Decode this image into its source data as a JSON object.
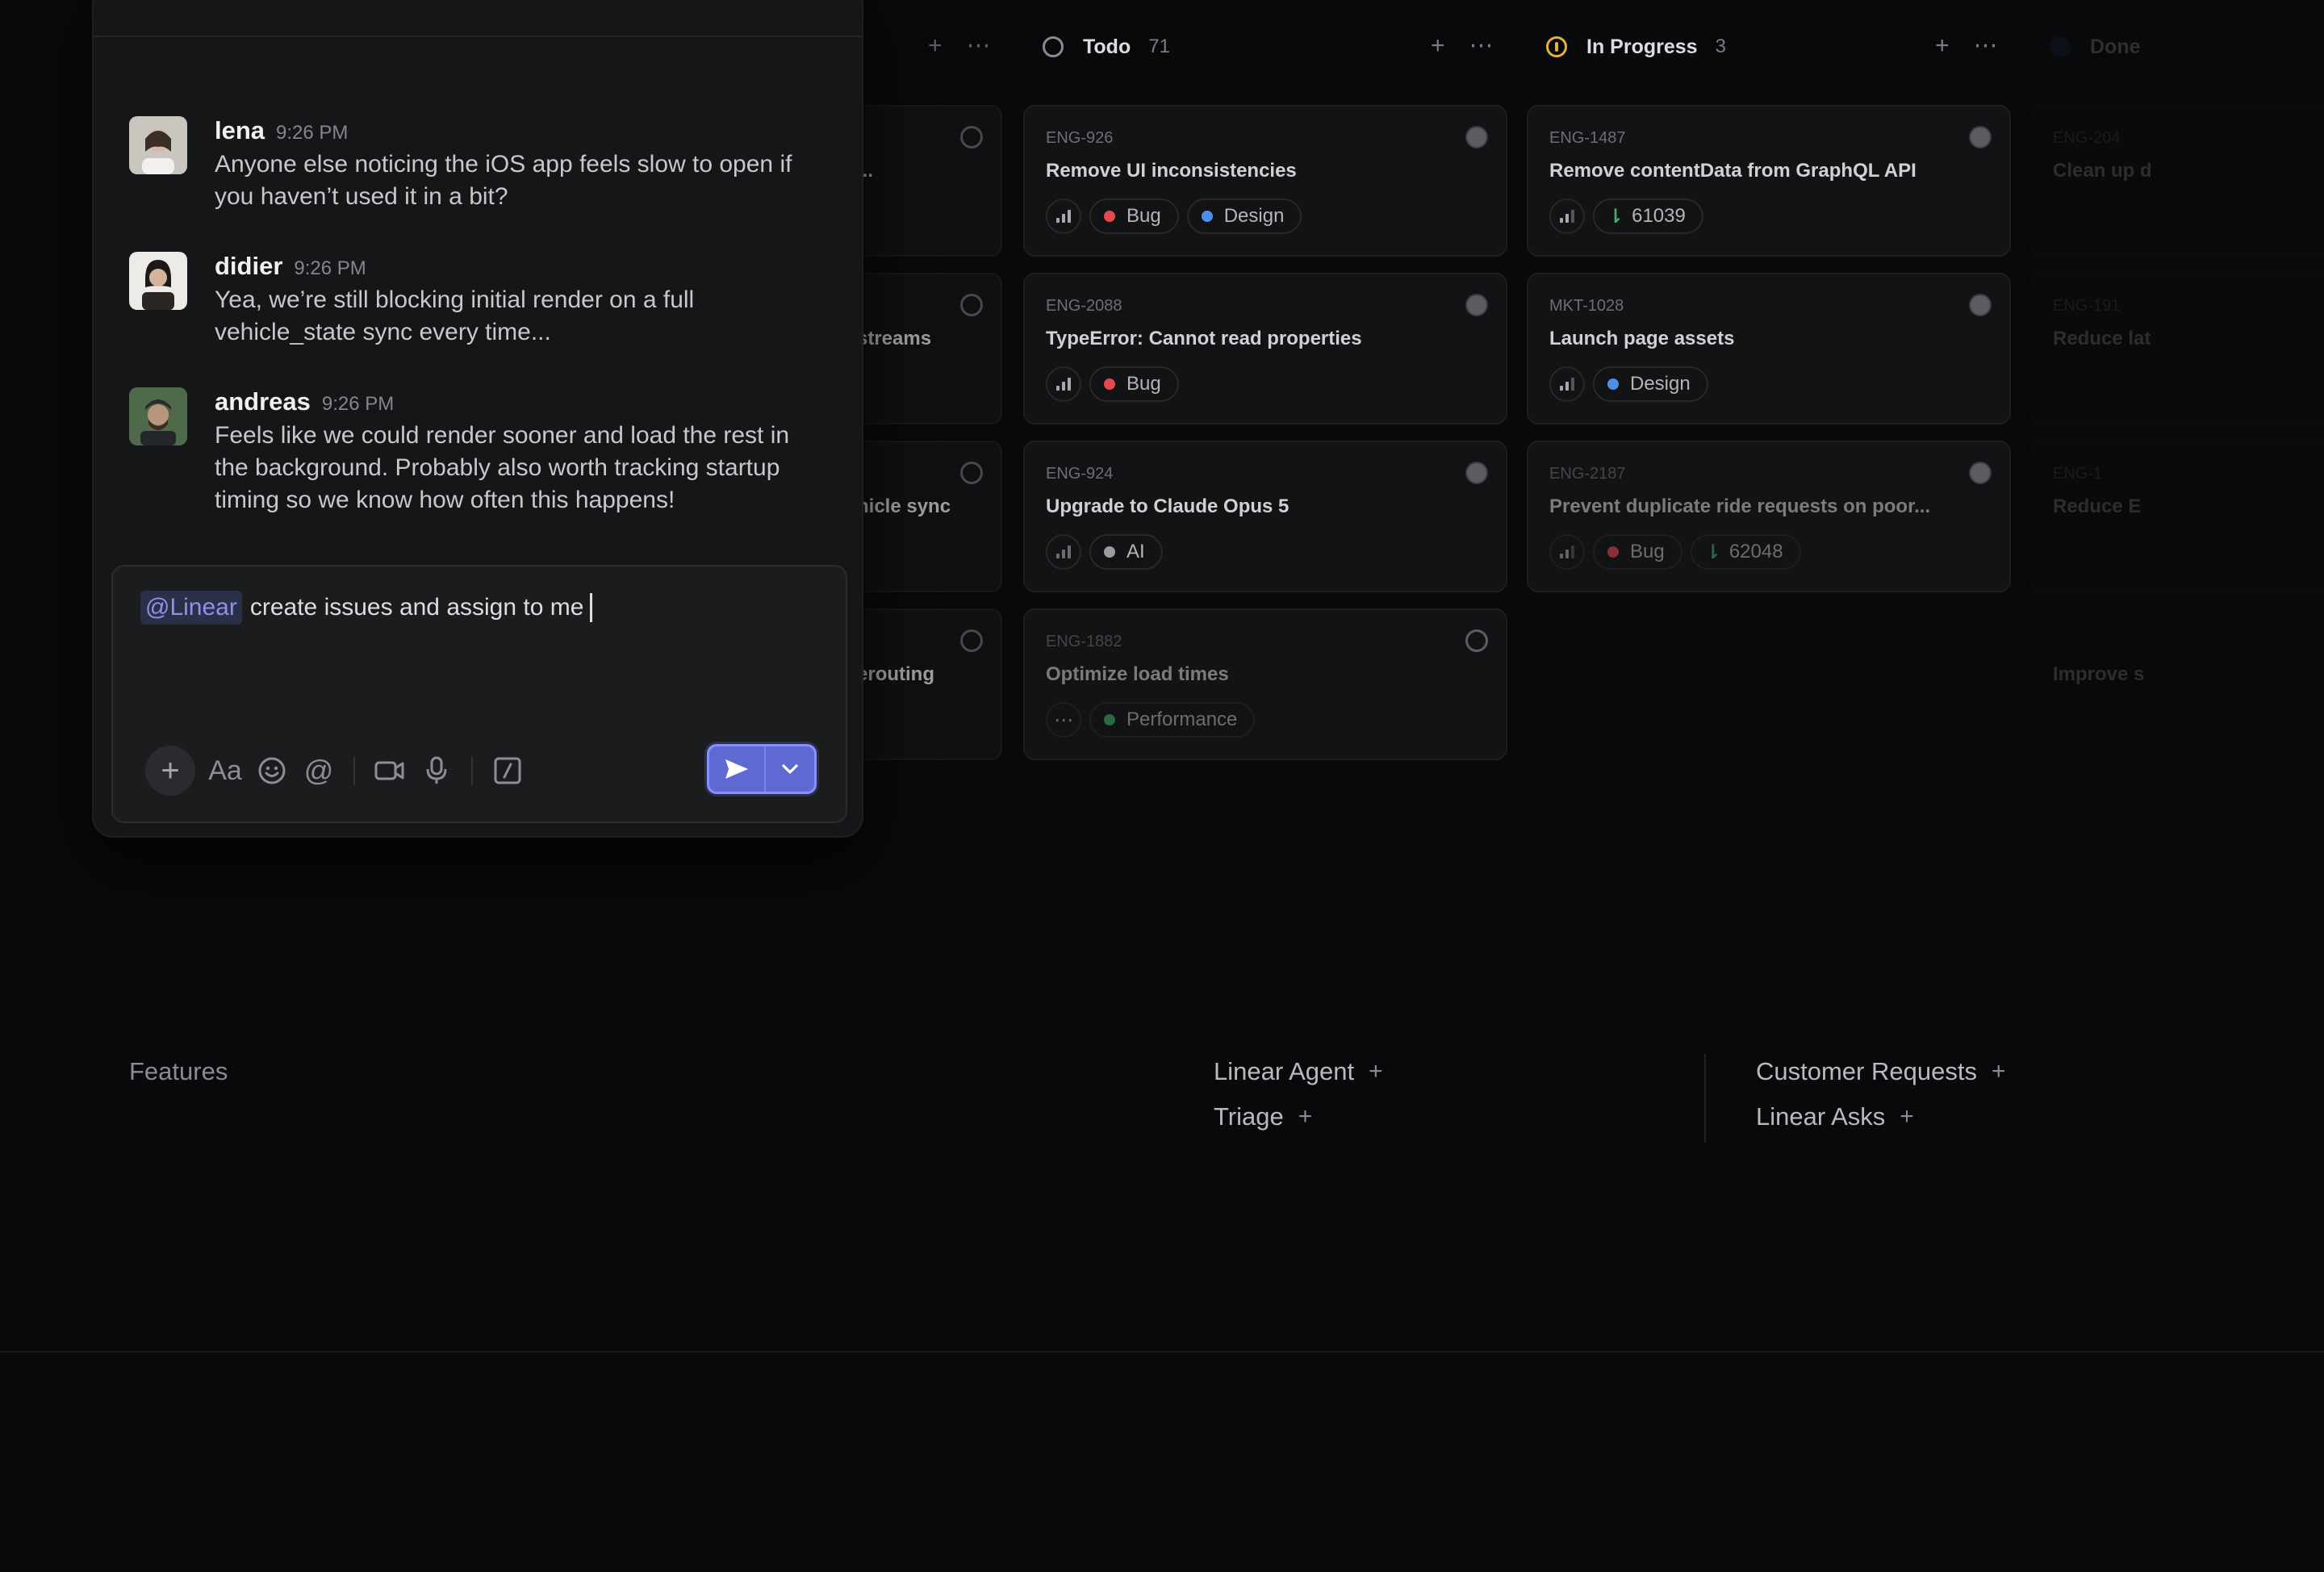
{
  "board": {
    "columns": [
      {
        "key": "left",
        "title": "",
        "count": ""
      },
      {
        "key": "todo",
        "title": "Todo",
        "count": "71"
      },
      {
        "key": "inprogress",
        "title": "In Progress",
        "count": "3"
      },
      {
        "key": "done",
        "title": "Done",
        "count": ""
      }
    ],
    "left_partial_titles": [
      "...",
      "streams",
      "hicle sync",
      "erouting"
    ],
    "todo_cards": [
      {
        "id": "ENG-926",
        "title": "Remove UI inconsistencies",
        "labels": [
          "Bug",
          "Design"
        ]
      },
      {
        "id": "ENG-2088",
        "title": "TypeError: Cannot read properties",
        "labels": [
          "Bug"
        ]
      },
      {
        "id": "ENG-924",
        "title": "Upgrade to Claude Opus 5",
        "labels": [
          "AI"
        ]
      },
      {
        "id": "ENG-1882",
        "title": "Optimize load times",
        "labels": [
          "Performance"
        ]
      }
    ],
    "inprogress_cards": [
      {
        "id": "ENG-1487",
        "title": "Remove contentData from GraphQL API",
        "pr": "61039"
      },
      {
        "id": "MKT-1028",
        "title": "Launch page assets",
        "labels": [
          "Design"
        ]
      },
      {
        "id": "ENG-2187",
        "title": "Prevent duplicate ride requests on poor...",
        "labels": [
          "Bug"
        ],
        "pr": "62048"
      }
    ],
    "done_partial": [
      {
        "id": "ENG-204",
        "title": "Clean up d"
      },
      {
        "id": "ENG-191",
        "title": "Reduce lat"
      },
      {
        "id": "ENG-1",
        "title": "Reduce E"
      },
      {
        "id": "",
        "title": "Improve s"
      }
    ],
    "colors": {
      "bug": "#e5484d",
      "design": "#4c8ee8",
      "ai": "#9a9ba0",
      "performance": "#3fae6b",
      "pr": "#3fae6b"
    }
  },
  "chat": {
    "messages": [
      {
        "user": "lena",
        "time": "9:26 PM",
        "text": "Anyone else noticing the iOS app feels slow to open if you haven’t used it in a bit?"
      },
      {
        "user": "didier",
        "time": "9:26 PM",
        "text": "Yea, we’re still blocking initial render on a full vehicle_state sync every time..."
      },
      {
        "user": "andreas",
        "time": "9:26 PM",
        "text": "Feels like we could render sooner and load the rest in the background. Probably also worth tracking startup timing so we know how often this happens!"
      }
    ],
    "composer": {
      "mention": "@Linear",
      "text": "create issues and assign to me"
    },
    "toolbar_icons": [
      "plus-icon",
      "text-format-icon",
      "emoji-icon",
      "at-mention-icon",
      "video-icon",
      "microphone-icon",
      "slash-command-icon"
    ],
    "send_color": "#5e6ad2"
  },
  "features": {
    "heading": "Features",
    "col1": [
      "Linear Agent",
      "Triage"
    ],
    "col2": [
      "Customer Requests",
      "Linear Asks"
    ]
  }
}
